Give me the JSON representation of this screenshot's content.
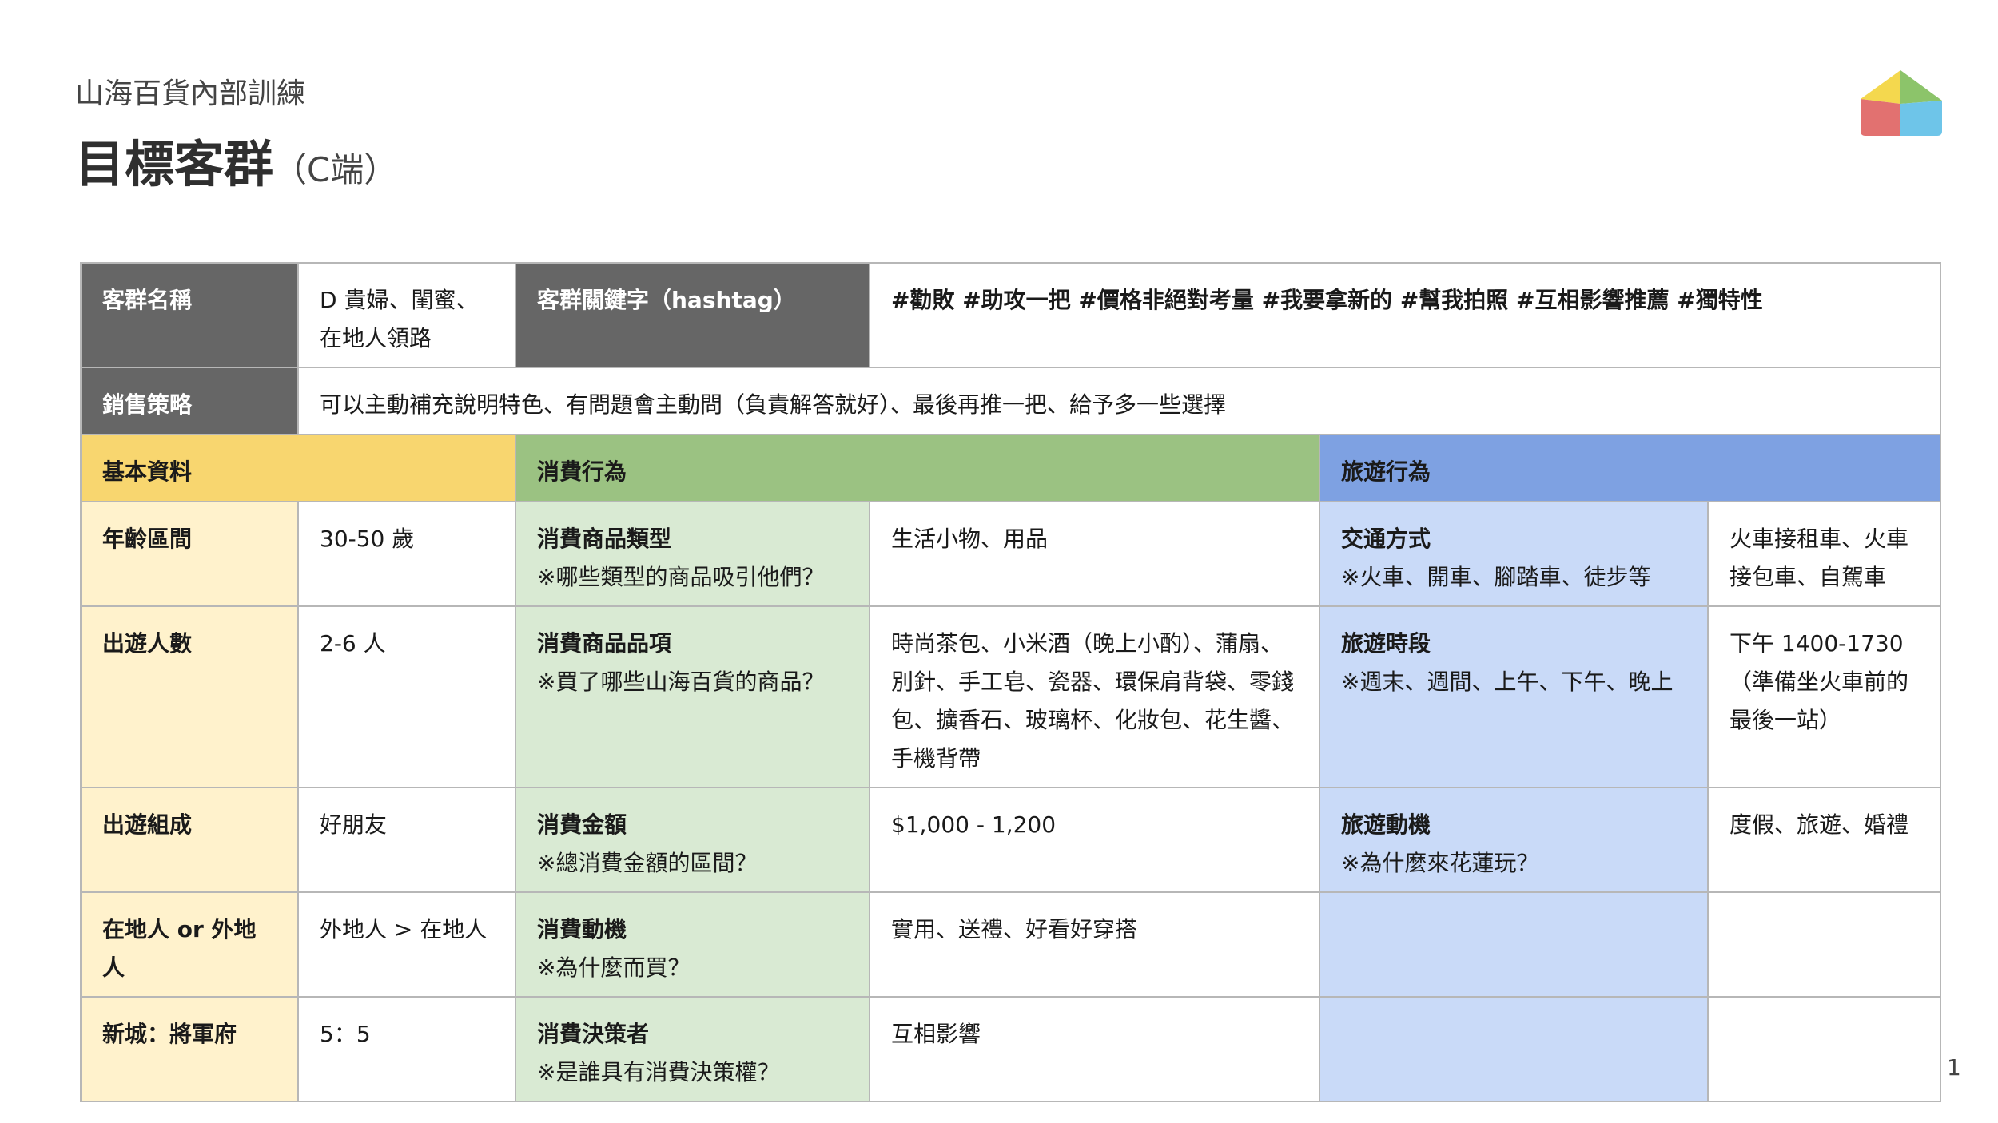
{
  "header": {
    "subtitle": "山海百貨內部訓練",
    "title": "目標客群",
    "title_suffix": "（C端）"
  },
  "page_number": "1",
  "logo": {
    "name": "house-logo",
    "colors": [
      "#f4d84e",
      "#8cc46a",
      "#e27170",
      "#6ec5e9"
    ]
  },
  "profile": {
    "name_label": "客群名稱",
    "name_value": "D 貴婦、閨蜜、在地人領路",
    "hashtag_label": "客群關鍵字（hashtag）",
    "hashtags": "#勸敗  #助攻一把  #價格非絕對考量  #我要拿新的 #幫我拍照 #互相影響推薦 #獨特性",
    "strategy_label": "銷售策略",
    "strategy_value": "可以主動補充說明特色、有問題會主動問（負責解答就好）、最後再推一把、給予多一些選擇"
  },
  "sections": {
    "basic": "基本資料",
    "spending": "消費行為",
    "travel": "旅遊行為"
  },
  "rows": [
    {
      "basic_label": "年齡區間",
      "basic_value": "30-50 歲",
      "spend_label": "消費商品類型",
      "spend_note": "※哪些類型的商品吸引他們？",
      "spend_value": "生活小物、用品",
      "travel_label": "交通方式",
      "travel_note": "※火車、開車、腳踏車、徒步等",
      "travel_value": "火車接租車、火車接包車、自駕車"
    },
    {
      "basic_label": "出遊人數",
      "basic_value": "2-6 人",
      "spend_label": "消費商品品項",
      "spend_note": "※買了哪些山海百貨的商品？",
      "spend_value": "時尚茶包、小米酒（晚上小酌）、蒲扇、別針、手工皂、瓷器、環保肩背袋、零錢包、擴香石、玻璃杯、化妝包、花生醬、手機背帶",
      "travel_label": "旅遊時段",
      "travel_note": "※週末、週間、上午、下午、晚上",
      "travel_value": "下午 1400-1730（準備坐火車前的最後一站）"
    },
    {
      "basic_label": "出遊組成",
      "basic_value": "好朋友",
      "spend_label": "消費金額",
      "spend_note": "※總消費金額的區間？",
      "spend_value": "$1,000 - 1,200",
      "travel_label": "旅遊動機",
      "travel_note": "※為什麼來花蓮玩？",
      "travel_value": "度假、旅遊、婚禮"
    },
    {
      "basic_label": "在地人 or 外地人",
      "basic_value": "外地人 > 在地人",
      "spend_label": "消費動機",
      "spend_note": "※為什麼而買？",
      "spend_value": "實用、送禮、好看好穿搭",
      "travel_label": "",
      "travel_note": "",
      "travel_value": ""
    },
    {
      "basic_label": "新城：將軍府",
      "basic_value": "5：5",
      "spend_label": "消費決策者",
      "spend_note": "※是誰具有消費決策權？",
      "spend_value": "互相影響",
      "travel_label": "",
      "travel_note": "",
      "travel_value": ""
    }
  ]
}
